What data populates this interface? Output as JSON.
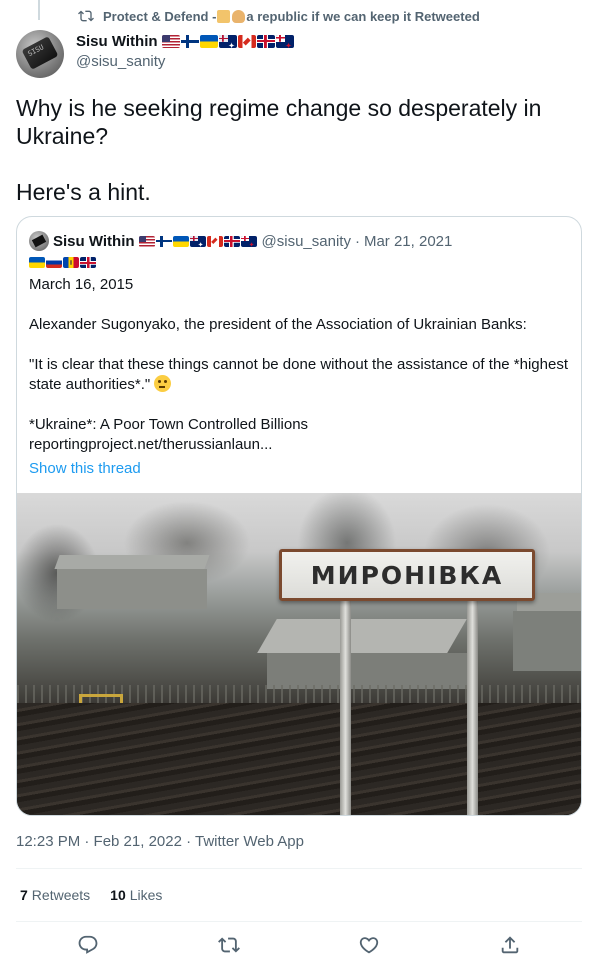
{
  "retweet_context": {
    "text_before": "Protect & Defend -",
    "text_after": "a republic if we can keep it Retweeted",
    "icon": "retweet-icon"
  },
  "author": {
    "name": "Sisu Within",
    "handle": "@sisu_sanity",
    "flags": [
      "us",
      "fi",
      "ua",
      "au",
      "ca",
      "gb",
      "nz"
    ]
  },
  "tweet": {
    "line1": "Why is he seeking regime change so desperately in Ukraine?",
    "line2": "Here's a hint."
  },
  "quoted_tweet": {
    "name": "Sisu Within",
    "handle": "@sisu_sanity",
    "date": "Mar 21, 2021",
    "flags_row1": [
      "us",
      "fi",
      "ua",
      "au",
      "ca",
      "gb",
      "nz"
    ],
    "flags_row2": [
      "ua",
      "ru",
      "md",
      "gb"
    ],
    "date_line": "March 16, 2015",
    "paragraph1": "Alexander Sugonyako, the president of the Association of Ukrainian Banks:",
    "paragraph2": "\"It is clear that these things cannot be done without the assistance of the *highest state authorities*.\"",
    "paragraph3_title": "*Ukraine*: A Poor Town Controlled Billions",
    "link": "reportingproject.net/therussianlaun...",
    "show_thread": "Show this thread",
    "photo": {
      "sign_text": "МИРОНІВКА"
    }
  },
  "meta": {
    "timestamp": "12:23 PM · Feb 21, 2022 · Twitter Web App"
  },
  "stats": {
    "retweets_count": "7",
    "retweets_label": "Retweets",
    "likes_count": "10",
    "likes_label": "Likes"
  },
  "actions": {
    "reply_icon": "reply-icon",
    "retweet_icon": "retweet-icon",
    "like_icon": "heart-icon",
    "share_icon": "share-icon"
  },
  "colors": {
    "text": "#0f1419",
    "secondary": "#536471",
    "link": "#1d9bf0",
    "border": "#cfd9de"
  }
}
